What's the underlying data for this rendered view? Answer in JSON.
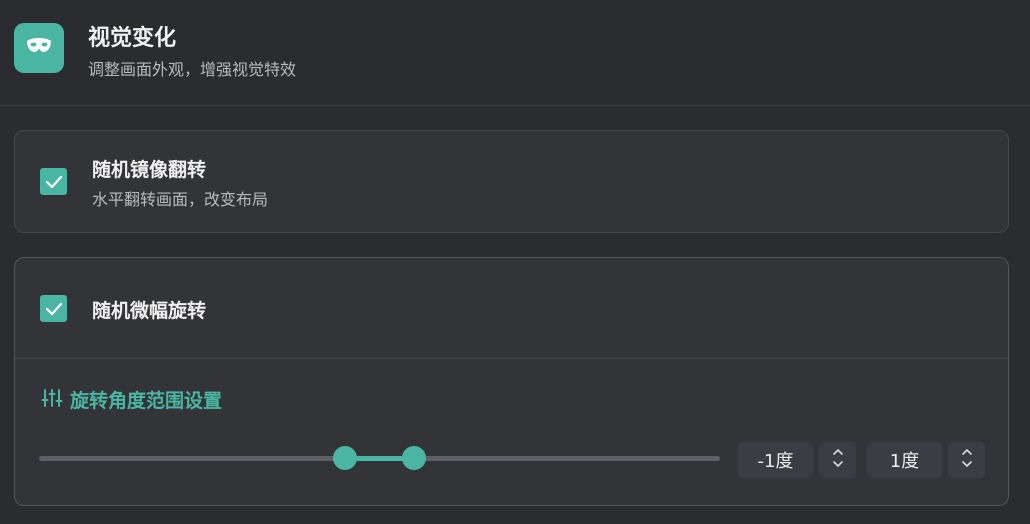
{
  "header": {
    "title": "视觉变化",
    "subtitle": "调整画面外观，增强视觉特效",
    "icon": "mask-icon"
  },
  "options": [
    {
      "title": "随机镜像翻转",
      "description": "水平翻转画面，改变布局",
      "checked": true
    },
    {
      "title": "随机微幅旋转",
      "checked": true
    }
  ],
  "rotation_range": {
    "section_title": "旋转角度范围设置",
    "section_icon": "sliders-icon",
    "min_label": "-1度",
    "max_label": "1度",
    "min_value": -1,
    "max_value": 1,
    "range_min": -10,
    "range_max": 10
  },
  "colors": {
    "accent": "#4bb5a4",
    "background": "#2b2c30",
    "card": "#333438"
  }
}
